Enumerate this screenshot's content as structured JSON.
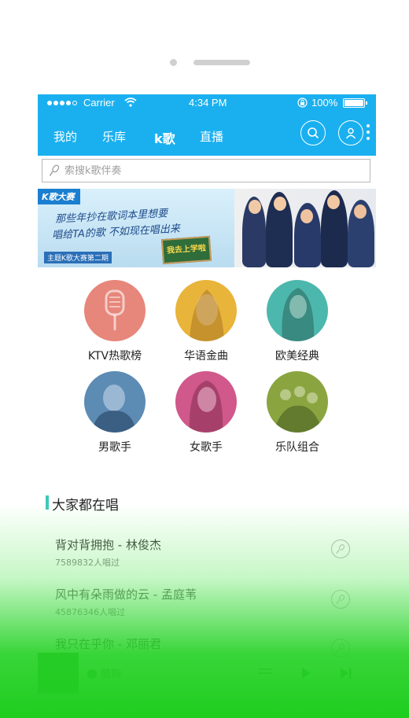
{
  "status": {
    "carrier": "Carrier",
    "time": "4:34 PM",
    "battery": "100%"
  },
  "nav": {
    "tabs": [
      {
        "label": "我的"
      },
      {
        "label": "乐库"
      },
      {
        "label": "k歌"
      },
      {
        "label": "直播"
      }
    ],
    "active_tab": "k歌"
  },
  "search": {
    "placeholder": "索搜k歌伴奏"
  },
  "banner": {
    "tag": "K歌大赛",
    "line1": "那些年抄在歌词本里想要",
    "line2": "唱给TA的歌 不如现在唱出来",
    "subtitle": "主题K歌大赛第二期",
    "board_text": "我去上学啦"
  },
  "categories": [
    {
      "label": "KTV热歌榜",
      "color": "#e7867a",
      "icon": "microphone-icon"
    },
    {
      "label": "华语金曲",
      "color": "#e9b43a",
      "icon": "woman-portrait-icon"
    },
    {
      "label": "欧美经典",
      "color": "#4cb7ad",
      "icon": "woman-portrait-icon"
    },
    {
      "label": "男歌手",
      "color": "#5c8bb4",
      "icon": "man-portrait-icon"
    },
    {
      "label": "女歌手",
      "color": "#d0588a",
      "icon": "woman-portrait-icon"
    },
    {
      "label": "乐队组合",
      "color": "#8aa540",
      "icon": "band-icon"
    }
  ],
  "section": {
    "title": "大家都在唱"
  },
  "songs": [
    {
      "title": "背对背拥抱 - 林俊杰",
      "count": "7589832人唱过"
    },
    {
      "title": "风中有朵雨做的云 - 孟庭苇",
      "count": "45876346人唱过"
    },
    {
      "title": "我只在乎你 - 邓丽君",
      "count": ""
    }
  ],
  "mini_player": {
    "name": "酷狗"
  },
  "colors": {
    "header": "#1ab0f0",
    "accent": "#3ec8b8",
    "overlay": "#1ecd1e"
  }
}
